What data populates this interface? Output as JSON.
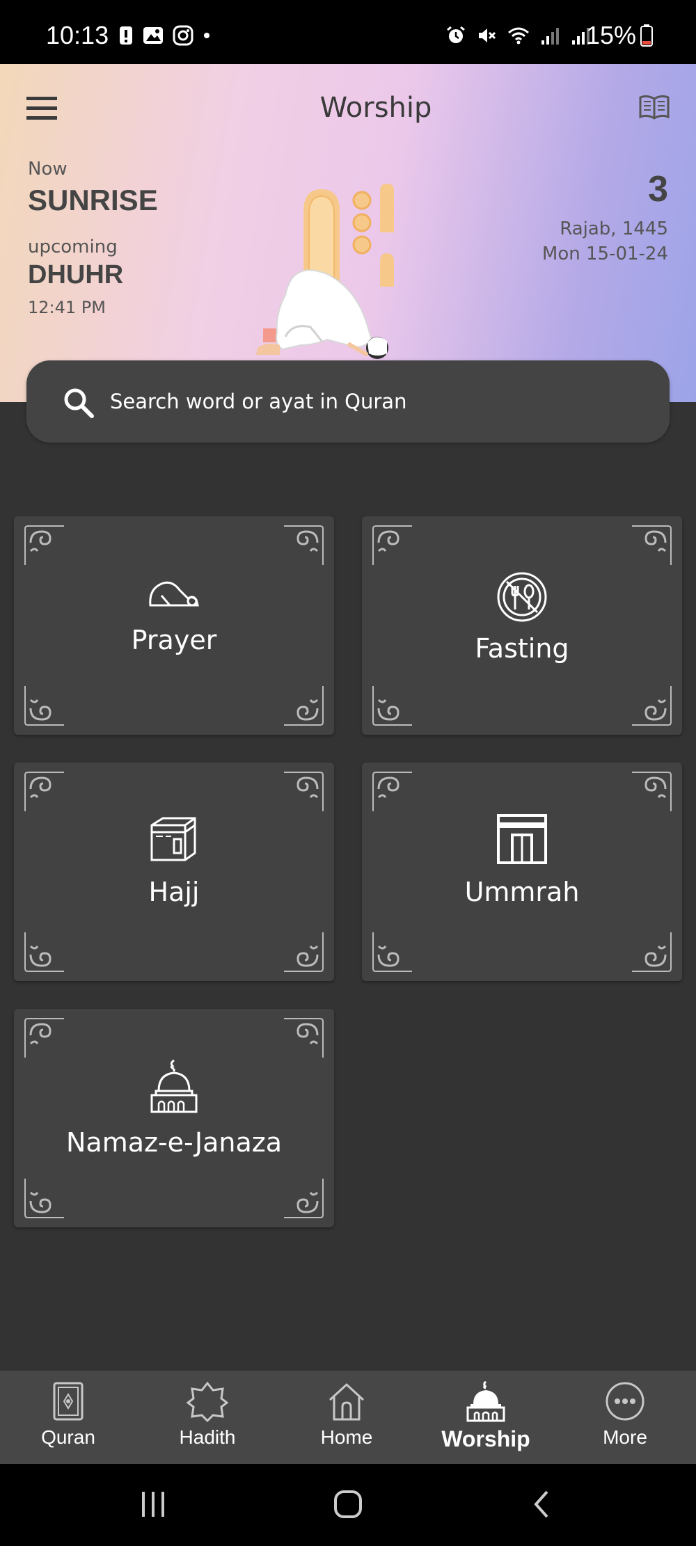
{
  "status_bar": {
    "time": "10:13",
    "battery": "15%"
  },
  "header": {
    "title": "Worship"
  },
  "prayer": {
    "now_label": "Now",
    "now_value": "SUNRISE",
    "upcoming_label": "upcoming",
    "upcoming_value": "DHUHR",
    "upcoming_time": "12:41 PM"
  },
  "date": {
    "day": "3",
    "hijri": "Rajab, 1445",
    "gregorian": "Mon 15-01-24"
  },
  "search": {
    "placeholder": "Search word or ayat in Quran"
  },
  "cards": [
    {
      "label": "Prayer",
      "icon": "prostration-icon"
    },
    {
      "label": "Fasting",
      "icon": "no-food-icon"
    },
    {
      "label": "Hajj",
      "icon": "kaaba-icon"
    },
    {
      "label": "Ummrah",
      "icon": "kaaba-door-icon"
    },
    {
      "label": "Namaz-e-Janaza",
      "icon": "mosque-icon"
    }
  ],
  "nav": [
    {
      "label": "Quran",
      "icon": "quran-icon"
    },
    {
      "label": "Hadith",
      "icon": "star-octagon-icon"
    },
    {
      "label": "Home",
      "icon": "home-icon"
    },
    {
      "label": "Worship",
      "icon": "mosque-icon",
      "active": true
    },
    {
      "label": "More",
      "icon": "more-icon"
    }
  ],
  "colors": {
    "background": "#333333",
    "card": "#424242",
    "nav": "#474747"
  }
}
